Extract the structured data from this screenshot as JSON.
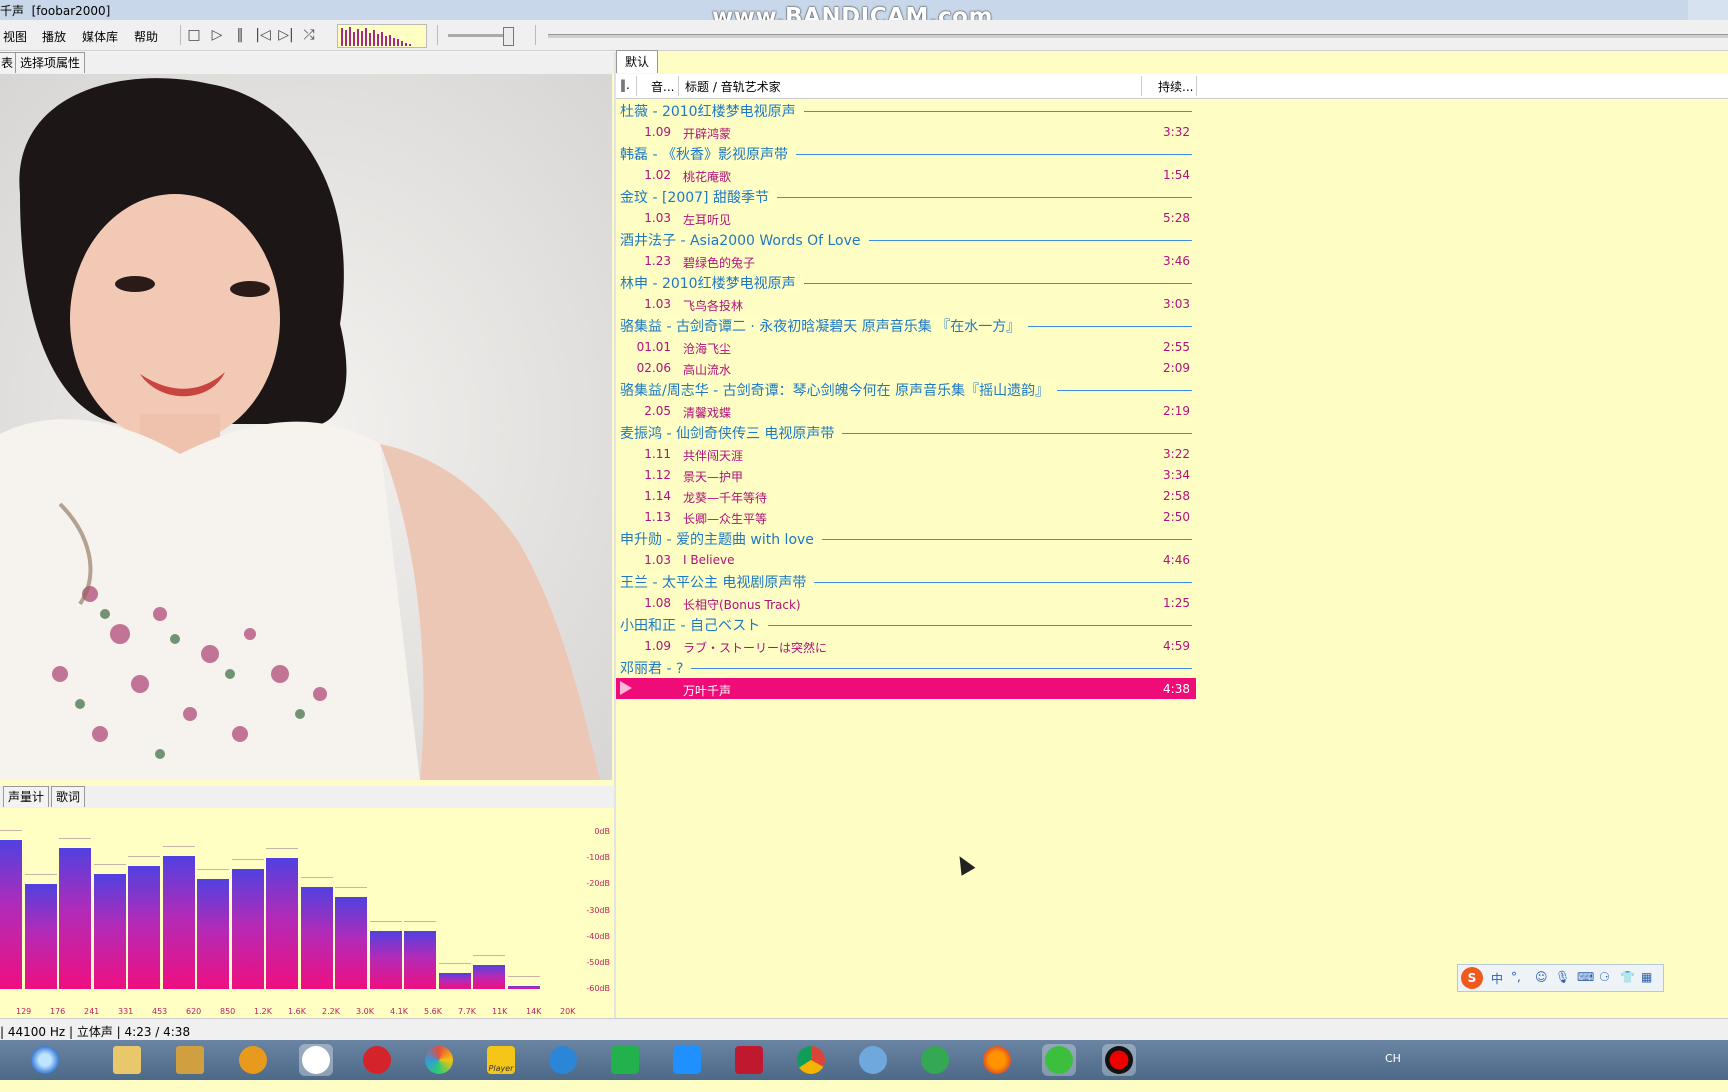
{
  "window": {
    "title": "千声  [foobar2000]",
    "watermark": "www.BANDICAM.com"
  },
  "menu": [
    "视图",
    "播放",
    "媒体库",
    "帮助"
  ],
  "left_tabs": [
    "表",
    "选择项属性"
  ],
  "lower_tabs": [
    "声量计",
    "歌词"
  ],
  "spectrum": {
    "db_labels": [
      "0dB",
      "-10dB",
      "-20dB",
      "-30dB",
      "-40dB",
      "-50dB",
      "-60dB"
    ],
    "freq_labels": [
      "129",
      "176",
      "241",
      "331",
      "453",
      "620",
      "850",
      "1.2K",
      "1.6K",
      "2.2K",
      "3.0K",
      "4.1K",
      "5.6K",
      "7.7K",
      "11K",
      "14K",
      "20K"
    ],
    "levels_db": [
      -3,
      -20,
      -6,
      -16,
      -13,
      -9,
      -18,
      -14,
      -10,
      -21,
      -25,
      -38,
      -38,
      -54,
      -51,
      -59
    ]
  },
  "playlist_tab": "默认",
  "columns": {
    "c1": "‖.",
    "c2": "音...",
    "title": "标题 / 音轨艺术家",
    "duration": "持续..."
  },
  "groups": [
    {
      "header": "杜薇 - 2010红楼梦电视原声",
      "tracks": [
        {
          "no": "1.09",
          "title": "开辟鸿蒙",
          "dur": "3:32"
        }
      ]
    },
    {
      "header": "韩磊 - 《秋香》影视原声带",
      "tracks": [
        {
          "no": "1.02",
          "title": "桃花庵歌",
          "dur": "1:54"
        }
      ]
    },
    {
      "header": "金玟 - [2007] 甜酸季节",
      "tracks": [
        {
          "no": "1.03",
          "title": "左耳听见",
          "dur": "5:28"
        }
      ]
    },
    {
      "header": "酒井法子 - Asia2000 Words Of Love",
      "tracks": [
        {
          "no": "1.23",
          "title": "碧绿色的兔子",
          "dur": "3:46"
        }
      ]
    },
    {
      "header": "林申 - 2010红楼梦电视原声",
      "tracks": [
        {
          "no": "1.03",
          "title": "飞鸟各投林",
          "dur": "3:03"
        }
      ]
    },
    {
      "header": "骆集益 - 古剑奇谭二 · 永夜初晗凝碧天 原声音乐集 『在水一方』",
      "tracks": [
        {
          "no": "01.01",
          "title": "沧海飞尘",
          "dur": "2:55"
        },
        {
          "no": "02.06",
          "title": "高山流水",
          "dur": "2:09"
        }
      ]
    },
    {
      "header": "骆集益/周志华 - 古剑奇谭：琴心剑魄今何在 原声音乐集『摇山遗韵』",
      "tracks": [
        {
          "no": "2.05",
          "title": "清馨戏蝶",
          "dur": "2:19"
        }
      ]
    },
    {
      "header": "麦振鸿 - 仙剑奇侠传三 电视原声带",
      "tracks": [
        {
          "no": "1.11",
          "title": "共伴闯天涯",
          "dur": "3:22"
        },
        {
          "no": "1.12",
          "title": "景天—护甲",
          "dur": "3:34"
        },
        {
          "no": "1.14",
          "title": "龙葵—千年等待",
          "dur": "2:58"
        },
        {
          "no": "1.13",
          "title": "长卿—众生平等",
          "dur": "2:50"
        }
      ]
    },
    {
      "header": "申升勋 - 爱的主题曲 with love",
      "tracks": [
        {
          "no": "1.03",
          "title": "I Believe",
          "dur": "4:46"
        }
      ]
    },
    {
      "header": "王兰 - 太平公主 电视剧原声带",
      "tracks": [
        {
          "no": "1.08",
          "title": "长相守(Bonus Track)",
          "dur": "1:25"
        }
      ]
    },
    {
      "header": "小田和正 - 自己ベスト",
      "tracks": [
        {
          "no": "1.09",
          "title": "ラブ・ストーリーは突然に",
          "dur": "4:59"
        }
      ]
    },
    {
      "header": "邓丽君 - ?",
      "tracks": [
        {
          "no": "",
          "title": "万叶千声",
          "dur": "4:38",
          "playing": true
        }
      ]
    }
  ],
  "status": "| 44100 Hz | 立体声 | 4:23 / 4:38",
  "ime": {
    "lang": "中",
    "tray_lang": "CH"
  },
  "taskbar": {
    "player_label": "Player"
  },
  "colors": {
    "group_header": "#1e78c6",
    "track_text": "#b0127a",
    "playing_bg": "#f00c78",
    "playlist_bg": "#fdfdc4"
  }
}
